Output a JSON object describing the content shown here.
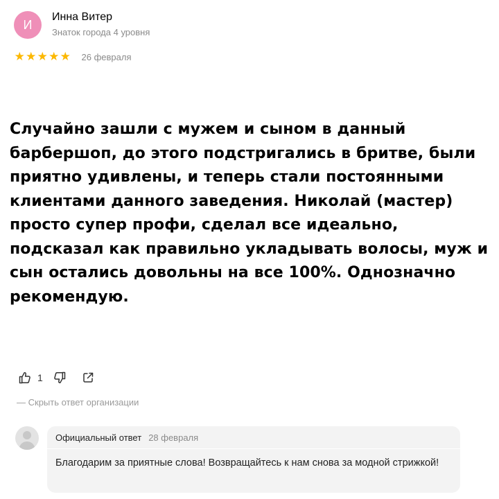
{
  "author": {
    "avatar_letter": "И",
    "avatar_color": "#ef8fb8",
    "name": "Инна Витер",
    "level": "Знаток города 4 уровня"
  },
  "review": {
    "rating": 5,
    "rating_max": 5,
    "star_color": "#fcb800",
    "date": "26 февраля",
    "text": "Случайно зашли с мужем и сыном в данный барбершоп, до этого подстригались в бритве, были приятно удивлены, и теперь стали постоянными клиентами данного заведения. Николай (мастер) просто супер профи, сделал все идеально, подсказал как правильно укладывать волосы, муж и сын остались довольны на все 100%. Однозначно рекомендую."
  },
  "actions": {
    "like_icon": "thumbs-up-icon",
    "like_count": "1",
    "dislike_icon": "thumbs-down-icon",
    "share_icon": "share-icon"
  },
  "hide_reply_label": "— Скрыть ответ организации",
  "official_reply": {
    "title": "Официальный ответ",
    "date": "28 февраля",
    "text": "Благодарим за приятные слова! Возвращайтесь к нам снова за модной стрижкой!"
  }
}
